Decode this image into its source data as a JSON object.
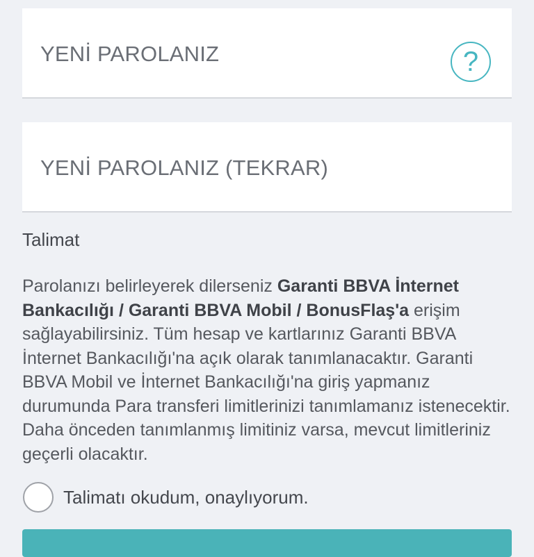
{
  "form": {
    "new_password_label": "YENİ PAROLANIZ",
    "help_icon_glyph": "?",
    "new_password_repeat_label": "YENİ PAROLANIZ (TEKRAR)"
  },
  "instructions": {
    "title": "Talimat",
    "text_1": "Parolanızı belirleyerek dilerseniz ",
    "bold_1": "Garanti BBVA İnternet Bankacılığı / Garanti BBVA Mobil / BonusFlaş'a",
    "text_2": " erişim sağlayabilirsiniz. Tüm hesap ve kartlarınız Garanti BBVA İnternet Bankacılığı'na açık olarak tanımlanacaktır. Garanti BBVA Mobil ve İnternet Bankacılığı'na giriş yapmanız durumunda Para transferi limitlerinizi tanımlamanız istenecektir. Daha önceden tanımlanmış limitiniz varsa, mevcut limitleriniz geçerli olacaktır."
  },
  "consent": {
    "label": "Talimatı okudum, onaylıyorum.",
    "checked": false
  },
  "colors": {
    "accent": "#47b6c1",
    "background": "#eff1f5"
  },
  "icons": {
    "help": "help-icon"
  }
}
